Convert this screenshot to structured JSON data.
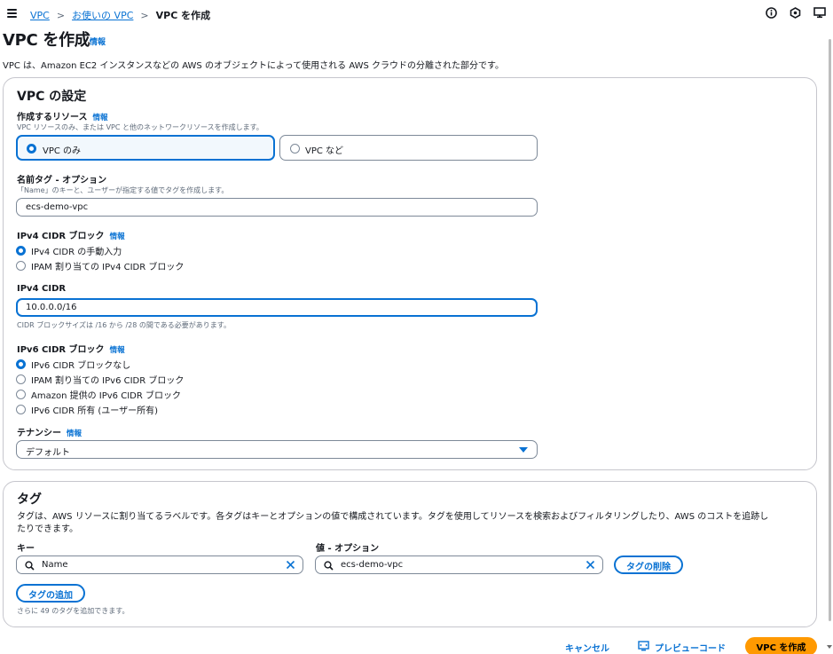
{
  "breadcrumb": {
    "item1": "VPC",
    "item2": "お使いの VPC",
    "current": "VPC を作成"
  },
  "page": {
    "title": "VPC を作成",
    "info": "情報",
    "description": "VPC は、Amazon EC2 インスタンスなどの AWS のオブジェクトによって使用される AWS クラウドの分離された部分です。"
  },
  "vpc_settings": {
    "heading": "VPC の設定",
    "resources": {
      "label": "作成するリソース",
      "info": "情報",
      "hint": "VPC リソースのみ、または VPC と他のネットワークリソースを作成します。",
      "option_vpc_only": "VPC のみ",
      "option_vpc_more": "VPC など",
      "selected": "VPC のみ"
    },
    "name_tag": {
      "label": "名前タグ - オプション",
      "hint": "「Name」のキーと、ユーザーが指定する値でタグを作成します。",
      "value": "ecs-demo-vpc"
    },
    "ipv4_block": {
      "label": "IPv4 CIDR ブロック",
      "info": "情報",
      "options": [
        "IPv4 CIDR の手動入力",
        "IPAM 割り当ての IPv4 CIDR ブロック"
      ],
      "selected": "IPv4 CIDR の手動入力"
    },
    "ipv4_cidr": {
      "label": "IPv4 CIDR",
      "value": "10.0.0.0/16",
      "hint": "CIDR ブロックサイズは /16 から /28 の間である必要があります。"
    },
    "ipv6_block": {
      "label": "IPv6 CIDR ブロック",
      "info": "情報",
      "options": [
        "IPv6 CIDR ブロックなし",
        "IPAM 割り当ての IPv6 CIDR ブロック",
        "Amazon 提供の IPv6 CIDR ブロック",
        "IPv6 CIDR 所有 (ユーザー所有)"
      ],
      "selected": "IPv6 CIDR ブロックなし"
    },
    "tenancy": {
      "label": "テナンシー",
      "info": "情報",
      "value": "デフォルト"
    }
  },
  "tags": {
    "heading": "タグ",
    "description_line1": "タグは、AWS リソースに割り当てるラベルです。各タグはキーとオプションの値で構成されています。タグを使用してリソースを検索およびフィルタリングしたり、AWS のコストを追跡し",
    "description_line2": "たりできます。",
    "key_label": "キー",
    "value_label": "値 - オプション",
    "key_value": "Name",
    "value_value": "ecs-demo-vpc",
    "remove_button": "タグの削除",
    "add_button": "タグの追加",
    "remaining_hint": "さらに 49 のタグを追加できます。"
  },
  "footer": {
    "cancel": "キャンセル",
    "preview": "プレビューコード",
    "create": "VPC を作成"
  },
  "colors": {
    "accent": "#0972d3",
    "primary_button": "#ff9900",
    "border": "#7d8998",
    "text": "#16191f",
    "muted": "#5f6b7a"
  }
}
